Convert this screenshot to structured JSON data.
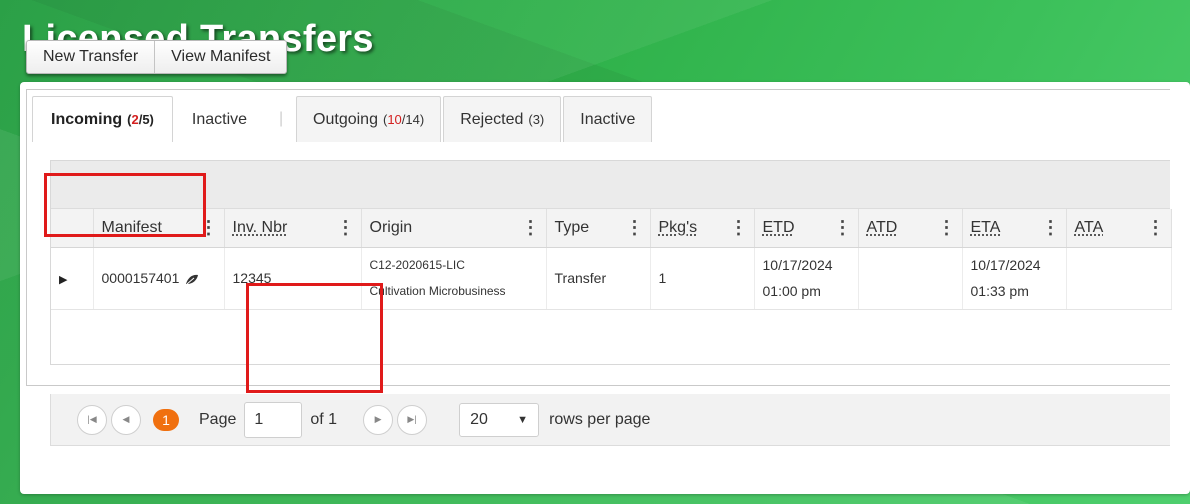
{
  "page": {
    "title": "Licensed Transfers"
  },
  "toolbar": {
    "new_transfer": "New Transfer",
    "view_manifest": "View Manifest"
  },
  "tabs": [
    {
      "label": "Incoming",
      "open": "(",
      "count_a": "2",
      "slash": "/",
      "count_b": "5",
      "close": ")",
      "active": true
    },
    {
      "label": "Inactive"
    },
    {
      "label": "Outgoing",
      "open": "(",
      "count_a": "10",
      "slash": "/",
      "count_b": "14",
      "close": ")"
    },
    {
      "label": "Rejected",
      "count": "(3)"
    },
    {
      "label": "Inactive"
    }
  ],
  "grid": {
    "columns": [
      "Manifest",
      "Inv. Nbr",
      "Origin",
      "Type",
      "Pkg's",
      "ETD",
      "ATD",
      "ETA",
      "ATA"
    ],
    "rows": [
      {
        "manifest": "0000157401",
        "inv_nbr": "12345",
        "origin_line1": "C12-2020615-LIC",
        "origin_line2": "Cultivation Microbusiness",
        "type": "Transfer",
        "pkgs": "1",
        "etd_date": "10/17/2024",
        "etd_time": "01:00 pm",
        "atd": "",
        "eta_date": "10/17/2024",
        "eta_time": "01:33 pm",
        "ata": ""
      }
    ]
  },
  "pager": {
    "current_page": "1",
    "page_label": "Page",
    "page_value": "1",
    "of_label": "of 1",
    "page_size": "20",
    "rows_label": "rows per page"
  },
  "colors": {
    "highlight": "#e01a1a",
    "accent_count": "#d42020",
    "pager_badge": "#f0700f",
    "banner_green": "#2fb14a"
  },
  "icons": {
    "row_manifest": "leaf-icon",
    "expand": "triangle-right-icon"
  }
}
